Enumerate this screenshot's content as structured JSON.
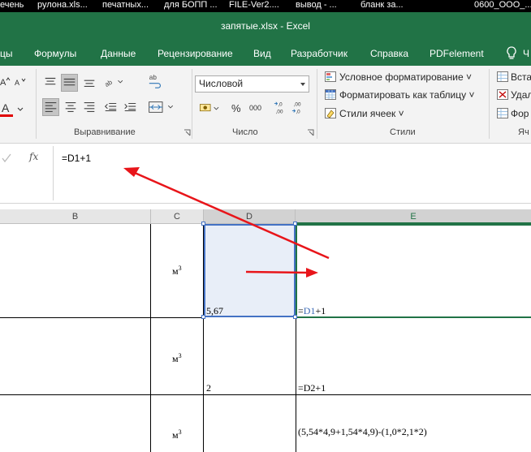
{
  "taskbar": {
    "items": [
      "ечень",
      "рулона.xls...",
      "печатных...",
      "для БОПП ...",
      "FILE-Ver2....",
      "вывод - ...",
      "бланк за...",
      "0600_ООО_..."
    ]
  },
  "window": {
    "title": "запятые.xlsx  -  Excel"
  },
  "ribbon_tabs": [
    "цы",
    "Формулы",
    "Данные",
    "Рецензирование",
    "Вид",
    "Разработчик",
    "Справка",
    "PDFelement",
    "Ч"
  ],
  "ribbon": {
    "groups": {
      "alignment_label": "Выравнивание",
      "number_label": "Число",
      "styles_label": "Стили",
      "cells_label": "Яч"
    },
    "number_format": "Числовой",
    "percent": "%",
    "thousands": "000",
    "styles": {
      "conditional": "Условное форматирование",
      "as_table": "Форматировать как таблицу",
      "cell_styles": "Стили ячеек"
    },
    "cells": {
      "insert": "Вста",
      "delete": "Удал",
      "format": "Фор"
    }
  },
  "formula_bar": {
    "fx": "fx",
    "formula": "=D1+1"
  },
  "columns": [
    "B",
    "C",
    "D",
    "E"
  ],
  "sheet": {
    "unit_base": "м",
    "unit_exp": "3",
    "rows": [
      {
        "d": "5,67",
        "e_prefix": "=",
        "e_ref": "D1",
        "e_suffix": "+1"
      },
      {
        "d": "2",
        "e": "=D2+1"
      },
      {
        "d": "",
        "e": "(5,54*4,9+1,54*4,9)-(1,0*2,1*2)"
      }
    ]
  },
  "colors": {
    "excel_green": "#217346",
    "selection_fill": "#e8eef8",
    "selection_border": "#4472c4",
    "arrow_red": "#e8151a"
  }
}
